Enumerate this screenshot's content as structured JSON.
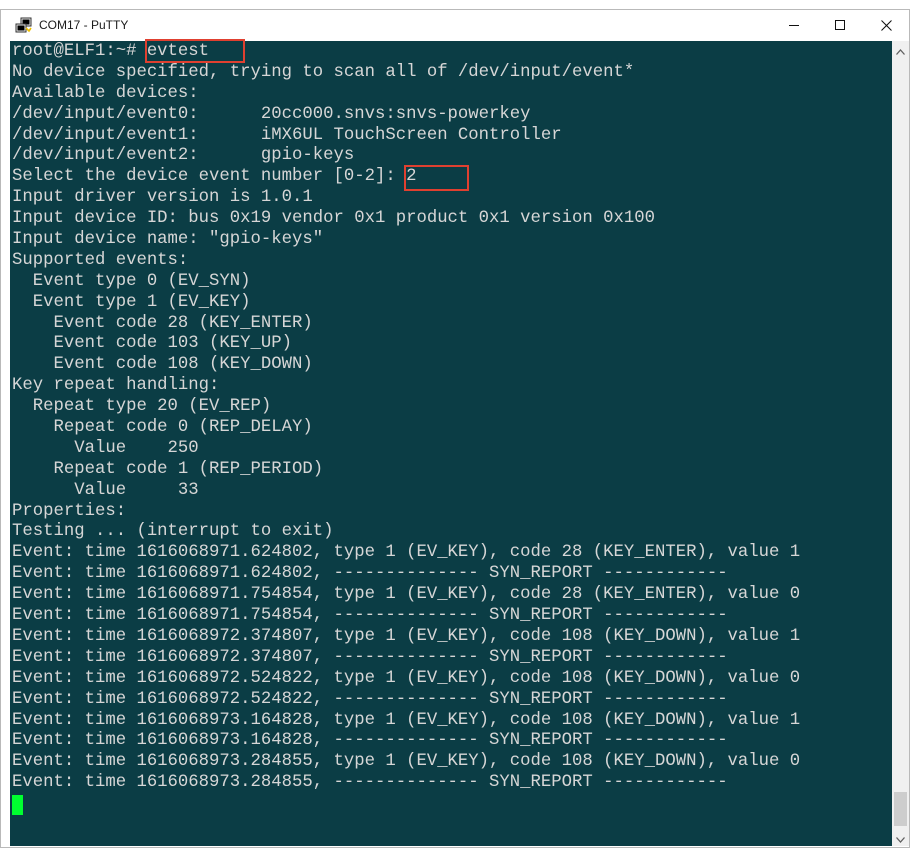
{
  "window": {
    "title": "COM17 - PuTTY",
    "icon": "putty-icon",
    "controls": {
      "minimize": "minimize-icon",
      "maximize": "maximize-icon",
      "close": "close-icon"
    }
  },
  "terminal": {
    "background": "#0b3d45",
    "foreground": "#d6d6d6",
    "cursor_color": "#00ff30",
    "highlight_color": "#e04030",
    "lines": [
      "root@ELF1:~# evtest",
      "No device specified, trying to scan all of /dev/input/event*",
      "Available devices:",
      "/dev/input/event0:      20cc000.snvs:snvs-powerkey",
      "/dev/input/event1:      iMX6UL TouchScreen Controller",
      "/dev/input/event2:      gpio-keys",
      "Select the device event number [0-2]: 2",
      "Input driver version is 1.0.1",
      "Input device ID: bus 0x19 vendor 0x1 product 0x1 version 0x100",
      "Input device name: \"gpio-keys\"",
      "Supported events:",
      "  Event type 0 (EV_SYN)",
      "  Event type 1 (EV_KEY)",
      "    Event code 28 (KEY_ENTER)",
      "    Event code 103 (KEY_UP)",
      "    Event code 108 (KEY_DOWN)",
      "Key repeat handling:",
      "  Repeat type 20 (EV_REP)",
      "    Repeat code 0 (REP_DELAY)",
      "      Value    250",
      "    Repeat code 1 (REP_PERIOD)",
      "      Value     33",
      "Properties:",
      "Testing ... (interrupt to exit)",
      "Event: time 1616068971.624802, type 1 (EV_KEY), code 28 (KEY_ENTER), value 1",
      "Event: time 1616068971.624802, -------------- SYN_REPORT ------------",
      "Event: time 1616068971.754854, type 1 (EV_KEY), code 28 (KEY_ENTER), value 0",
      "Event: time 1616068971.754854, -------------- SYN_REPORT ------------",
      "Event: time 1616068972.374807, type 1 (EV_KEY), code 108 (KEY_DOWN), value 1",
      "Event: time 1616068972.374807, -------------- SYN_REPORT ------------",
      "Event: time 1616068972.524822, type 1 (EV_KEY), code 108 (KEY_DOWN), value 0",
      "Event: time 1616068972.524822, -------------- SYN_REPORT ------------",
      "Event: time 1616068973.164828, type 1 (EV_KEY), code 108 (KEY_DOWN), value 1",
      "Event: time 1616068973.164828, -------------- SYN_REPORT ------------",
      "Event: time 1616068973.284855, type 1 (EV_KEY), code 108 (KEY_DOWN), value 0",
      "Event: time 1616068973.284855, -------------- SYN_REPORT ------------"
    ]
  }
}
